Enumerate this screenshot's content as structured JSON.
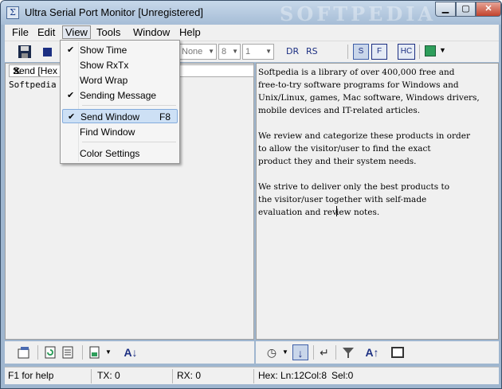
{
  "window": {
    "title": "Ultra Serial Port Monitor [Unregistered]",
    "watermark": "SOFTPEDIA"
  },
  "menubar": {
    "items": [
      "File",
      "Edit",
      "View",
      "Tools",
      "Window",
      "Help"
    ]
  },
  "toolbar": {
    "parity_value": "None",
    "databits_value": "8",
    "stopbits_value": "1",
    "dr_label": "DR",
    "rs_label": "RS",
    "s_label": "S",
    "f_label": "F",
    "hc_label": "HC"
  },
  "left_panel": {
    "header": "Send [Hex",
    "content": "Softpedia"
  },
  "right_panel": {
    "lines_before_caret": "Softpedia is a library of over 400,000 free and\nfree-to-try software programs for Windows and\nUnix/Linux, games, Mac software, Windows drivers,\nmobile devices and IT-related articles.\n\nWe review and categorize these products in order\nto allow the visitor/user to find the exact\nproduct they and their system needs.\n\nWe strive to deliver only the best products to\nthe visitor/user together with self-made\nevaluation and rev",
    "lines_after_caret": "iew notes."
  },
  "view_menu": {
    "items": [
      {
        "label": "Show Time",
        "checked": true
      },
      {
        "label": "Show RxTx",
        "checked": false
      },
      {
        "label": "Word Wrap",
        "checked": false
      },
      {
        "label": "Sending Message",
        "checked": true
      },
      {
        "label": "Send Window",
        "checked": true,
        "shortcut": "F8",
        "highlighted": true
      },
      {
        "label": "Find Window",
        "checked": false
      },
      {
        "label": "Color Settings",
        "checked": false
      }
    ]
  },
  "status": {
    "help": "F1 for help",
    "tx": "TX: 0",
    "rx": "RX: 0",
    "hex": "Hex: Ln:12",
    "col": "Col:8",
    "sel": "Sel:0"
  },
  "colors": {
    "accent": "#1c2f82",
    "green_swatch": "#2e9e5b",
    "highlight": "#cde0f5"
  }
}
